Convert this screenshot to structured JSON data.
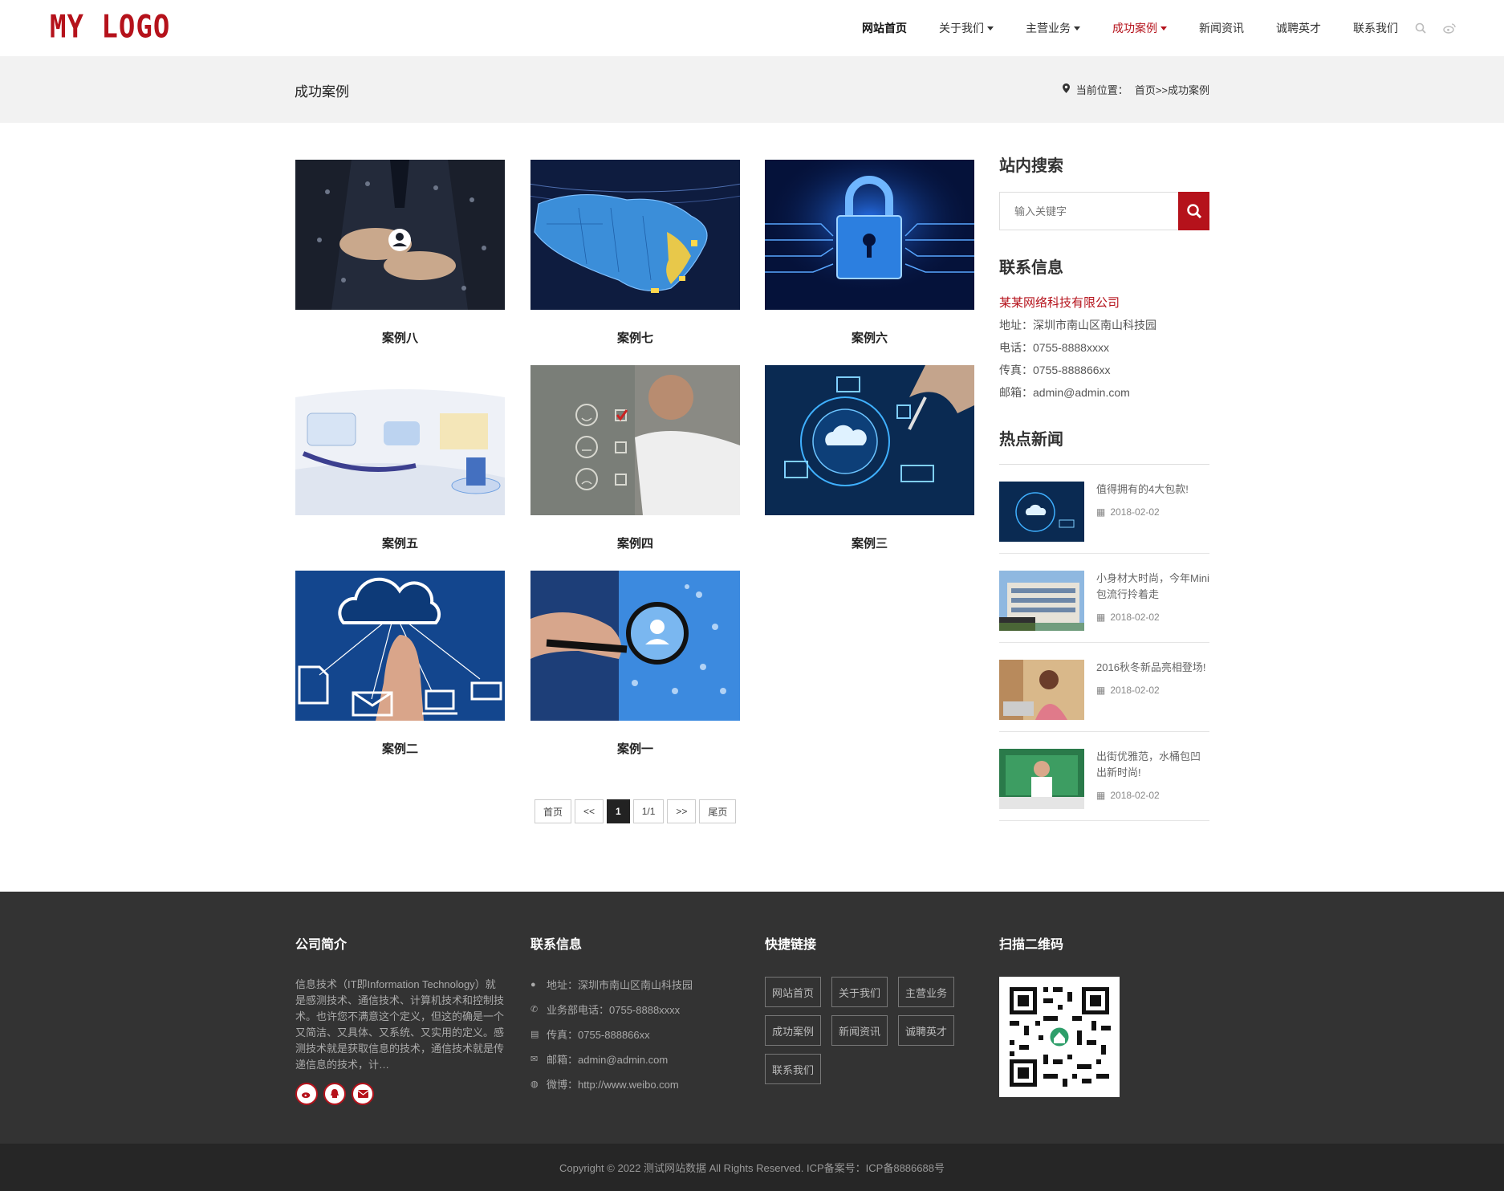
{
  "header": {
    "logo": "MY LOGO",
    "nav": [
      {
        "label": "网站首页"
      },
      {
        "label": "关于我们"
      },
      {
        "label": "主营业务"
      },
      {
        "label": "成功案例"
      },
      {
        "label": "新闻资讯"
      },
      {
        "label": "诚聘英才"
      },
      {
        "label": "联系我们"
      }
    ],
    "icons": [
      "search-icon",
      "weibo-icon"
    ]
  },
  "banner": {
    "title": "成功案例",
    "crumb_prefix": "当前位置：",
    "crumb_path": "首页>>成功案例"
  },
  "cases": [
    {
      "title": "案例八"
    },
    {
      "title": "案例七"
    },
    {
      "title": "案例六"
    },
    {
      "title": "案例五"
    },
    {
      "title": "案例四"
    },
    {
      "title": "案例三"
    },
    {
      "title": "案例二"
    },
    {
      "title": "案例一"
    }
  ],
  "pager": {
    "first": "首页",
    "prev": "<<",
    "current": "1",
    "info": "1/1",
    "next": ">>",
    "last": "尾页"
  },
  "sidebar": {
    "search_title": "站内搜索",
    "search_placeholder": "输入关键字",
    "contact_title": "联系信息",
    "company": "某某网络科技有限公司",
    "address": "地址：深圳市南山区南山科技园",
    "phone": "电话：0755-8888xxxx",
    "fax": "传真：0755-888866xx",
    "email": "邮箱：admin@admin.com",
    "news_title": "热点新闻",
    "news": [
      {
        "title": "值得拥有的4大包款!",
        "date": "2018-02-02"
      },
      {
        "title": "小身材大时尚，今年Mini包流行拎着走",
        "date": "2018-02-02"
      },
      {
        "title": "2016秋冬新品亮相登场!",
        "date": "2018-02-02"
      },
      {
        "title": "出街优雅范，水桶包凹出新时尚!",
        "date": "2018-02-02"
      }
    ]
  },
  "footer": {
    "about_title": "公司简介",
    "about_text": "信息技术（IT即Information Technology）就是感测技术、通信技术、计算机技术和控制技术。也许您不满意这个定义，但这的确是一个又简洁、又具体、又系统、又实用的定义。感测技术就是获取信息的技术，通信技术就是传递信息的技术，计…",
    "contact_title": "联系信息",
    "address": "地址：深圳市南山区南山科技园",
    "phone": "业务部电话：0755-8888xxxx",
    "fax": "传真：0755-888866xx",
    "email": "邮箱：admin@admin.com",
    "weibo": "微博：http://www.weibo.com",
    "links_title": "快捷链接",
    "links": [
      "网站首页",
      "关于我们",
      "主营业务",
      "成功案例",
      "新闻资讯",
      "诚聘英才",
      "联系我们"
    ],
    "qr_title": "扫描二维码",
    "copyright": "Copyright © 2022 测试网站数据 All Rights Reserved.   ICP备案号：ICP备8886688号"
  },
  "colors": {
    "brand": "#b5121b",
    "footer_bg": "#333333",
    "banner_bg": "#f2f2f2"
  }
}
